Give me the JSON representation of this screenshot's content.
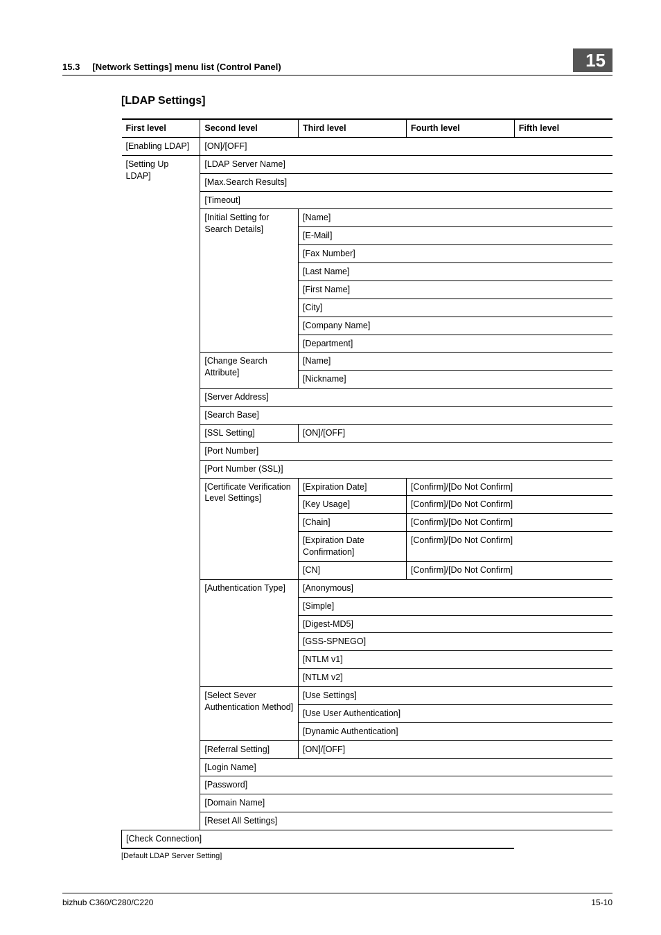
{
  "header": {
    "section_no": "15.3",
    "section_title": "[Network Settings] menu list (Control Panel)",
    "chapter_no": "15"
  },
  "title": "[LDAP Settings]",
  "columns": [
    "First level",
    "Second level",
    "Third level",
    "Fourth level",
    "Fifth level"
  ],
  "rows": {
    "enabling_ldap": {
      "l1": "[Enabling LDAP]",
      "l2": "[ON]/[OFF]"
    },
    "setting_up": {
      "l1": "[Setting Up LDAP]"
    },
    "server_name": "[LDAP Server Name]",
    "max_search": "[Max.Search Results]",
    "timeout": "[Timeout]",
    "init_search": "[Initial Setting for Search Details]",
    "init_items": [
      "[Name]",
      "[E-Mail]",
      "[Fax Number]",
      "[Last Name]",
      "[First Name]",
      "[City]",
      "[Company Name]",
      "[Department]"
    ],
    "change_attr": "[Change Search Attribute]",
    "change_items": [
      "[Name]",
      "[Nickname]"
    ],
    "server_addr": "[Server Address]",
    "search_base": "[Search Base]",
    "ssl_setting": "[SSL Setting]",
    "ssl_val": "[ON]/[OFF]",
    "port_number": "[Port Number]",
    "port_number_ssl": "[Port Number (SSL)]",
    "cert_verif": "[Certificate Verification Level Settings]",
    "cert_items": [
      {
        "l3": "[Expiration Date]",
        "l4": "[Confirm]/[Do Not Confirm]"
      },
      {
        "l3": "[Key Usage]",
        "l4": "[Confirm]/[Do Not Confirm]"
      },
      {
        "l3": "[Chain]",
        "l4": "[Confirm]/[Do Not Confirm]"
      },
      {
        "l3": "[Expiration Date Confirmation]",
        "l4": "[Confirm]/[Do Not Confirm]"
      },
      {
        "l3": "[CN]",
        "l4": "[Confirm]/[Do Not Confirm]"
      }
    ],
    "auth_type": "[Authentication Type]",
    "auth_items": [
      "[Anonymous]",
      "[Simple]",
      "[Digest-MD5]",
      "[GSS-SPNEGO]",
      "[NTLM v1]",
      "[NTLM v2]"
    ],
    "select_auth": "[Select Sever Authentication Method]",
    "select_items": [
      "[Use Settings]",
      "[Use User Authentication]",
      "[Dynamic Authentication]"
    ],
    "referral": "[Referral Setting]",
    "referral_val": "[ON]/[OFF]",
    "login_name": "[Login Name]",
    "password": "[Password]",
    "domain_name": "[Domain Name]",
    "reset_all": "[Reset All Settings]",
    "check_conn": "[Check Connection]"
  },
  "footnote": "[Default LDAP Server Setting]",
  "footer": {
    "left": "bizhub C360/C280/C220",
    "right": "15-10"
  }
}
